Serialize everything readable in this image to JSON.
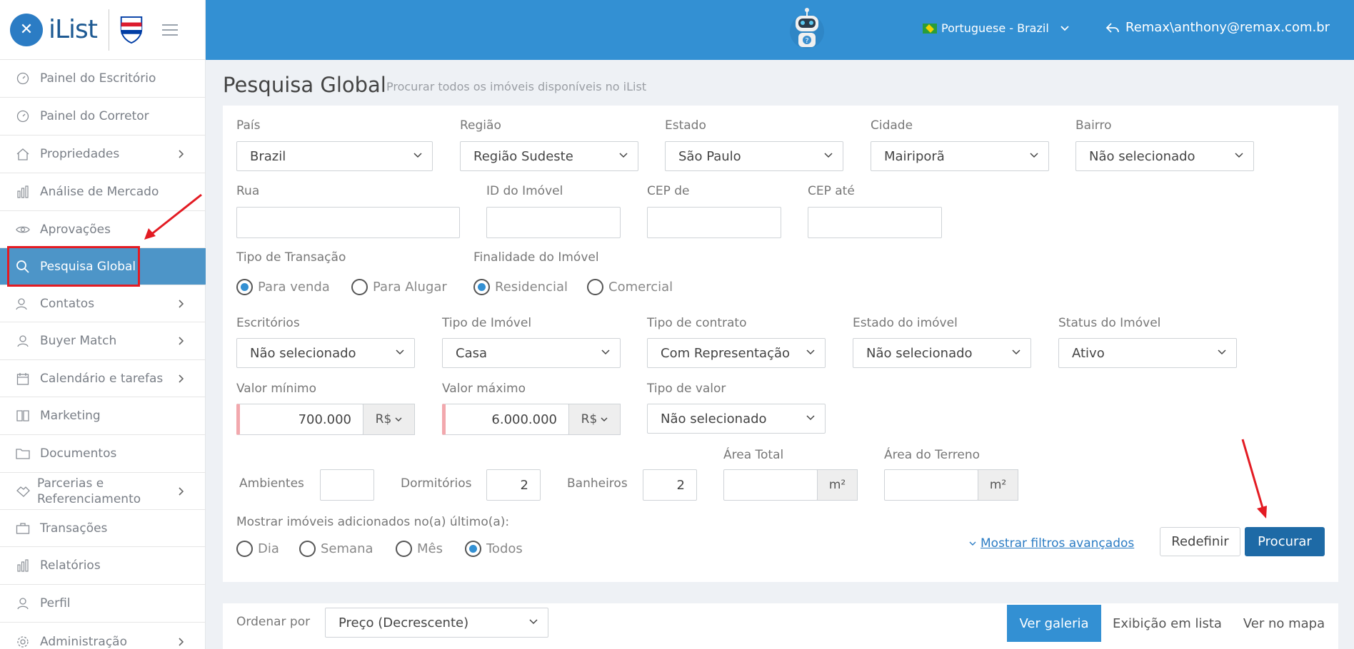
{
  "app": {
    "logo_text": "iList",
    "remax_text": "RE/MAX"
  },
  "topbar": {
    "language": "Portuguese - Brazil",
    "user": "Remax\\anthony@remax.com.br"
  },
  "sidebar": {
    "items": [
      {
        "label": "Painel do Escritório",
        "icon": "speedometer-icon"
      },
      {
        "label": "Painel do Corretor",
        "icon": "speedometer-icon"
      },
      {
        "label": "Propriedades",
        "icon": "home-icon"
      },
      {
        "label": "Análise de Mercado",
        "icon": "bar-chart-icon"
      },
      {
        "label": "Aprovações",
        "icon": "eye-icon"
      },
      {
        "label": "Pesquisa Global",
        "icon": "search-icon"
      },
      {
        "label": "Contatos",
        "icon": "contacts-icon"
      },
      {
        "label": "Buyer Match",
        "icon": "user-icon"
      },
      {
        "label": "Calendário e tarefas",
        "icon": "calendar-icon"
      },
      {
        "label": "Marketing",
        "icon": "book-icon"
      },
      {
        "label": "Documentos",
        "icon": "folder-icon"
      },
      {
        "label": "Parcerias e",
        "label2": "Referenciamento",
        "icon": "handshake-icon"
      },
      {
        "label": "Transações",
        "icon": "briefcase-icon"
      },
      {
        "label": "Relatórios",
        "icon": "bar-chart-icon"
      },
      {
        "label": "Perfil",
        "icon": "user-icon"
      },
      {
        "label": "Administração",
        "icon": "gear-icon"
      }
    ]
  },
  "page": {
    "title": "Pesquisa Global",
    "subtitle": "Procurar todos os imóveis disponíveis no iList"
  },
  "form": {
    "pais": {
      "label": "País",
      "value": "Brazil"
    },
    "regiao": {
      "label": "Região",
      "value": "Região Sudeste"
    },
    "estado": {
      "label": "Estado",
      "value": "São Paulo"
    },
    "cidade": {
      "label": "Cidade",
      "value": "Mairiporã"
    },
    "bairro": {
      "label": "Bairro",
      "value": "Não selecionado"
    },
    "rua": {
      "label": "Rua",
      "value": ""
    },
    "id_imovel": {
      "label": "ID do Imóvel",
      "value": ""
    },
    "cep_de": {
      "label": "CEP de",
      "value": ""
    },
    "cep_ate": {
      "label": "CEP até",
      "value": ""
    },
    "tipo_transacao": {
      "label": "Tipo de Transação",
      "options": [
        "Para venda",
        "Para Alugar"
      ],
      "selected": "Para venda"
    },
    "finalidade": {
      "label": "Finalidade do Imóvel",
      "options": [
        "Residencial",
        "Comercial"
      ],
      "selected": "Residencial"
    },
    "escritorios": {
      "label": "Escritórios",
      "value": "Não selecionado"
    },
    "tipo_imovel": {
      "label": "Tipo de Imóvel",
      "value": "Casa"
    },
    "tipo_contrato": {
      "label": "Tipo de contrato",
      "value": "Com Representação"
    },
    "estado_imovel": {
      "label": "Estado do imóvel",
      "value": "Não selecionado"
    },
    "status_imovel": {
      "label": "Status do Imóvel",
      "value": "Ativo"
    },
    "valor_min": {
      "label": "Valor mínimo",
      "value": "700.000",
      "currency": "R$"
    },
    "valor_max": {
      "label": "Valor máximo",
      "value": "6.000.000",
      "currency": "R$"
    },
    "tipo_valor": {
      "label": "Tipo de valor",
      "value": "Não selecionado"
    },
    "ambientes": {
      "label": "Ambientes",
      "value": ""
    },
    "dormitorios": {
      "label": "Dormitórios",
      "value": "2"
    },
    "banheiros": {
      "label": "Banheiros",
      "value": "2"
    },
    "area_total": {
      "label": "Área Total",
      "value": "",
      "unit": "m²"
    },
    "area_terreno": {
      "label": "Área do Terreno",
      "value": "",
      "unit": "m²"
    },
    "periodo": {
      "label": "Mostrar imóveis adicionados no(a) último(a):",
      "options": [
        "Dia",
        "Semana",
        "Mês",
        "Todos"
      ],
      "selected": "Todos"
    },
    "advanced_link": "Mostrar filtros avançados",
    "reset_button": "Redefinir",
    "search_button": "Procurar"
  },
  "results": {
    "sort_label": "Ordenar por",
    "sort_value": "Preço (Decrescente)",
    "tabs": [
      "Ver galeria",
      "Exibição em lista",
      "Ver no mapa"
    ],
    "active_tab": "Ver galeria"
  },
  "colors": {
    "primary": "#3390d3",
    "sidebar_active": "#4d95c8",
    "button_dark": "#1e6aa6",
    "annotation_red": "#e31b23"
  }
}
